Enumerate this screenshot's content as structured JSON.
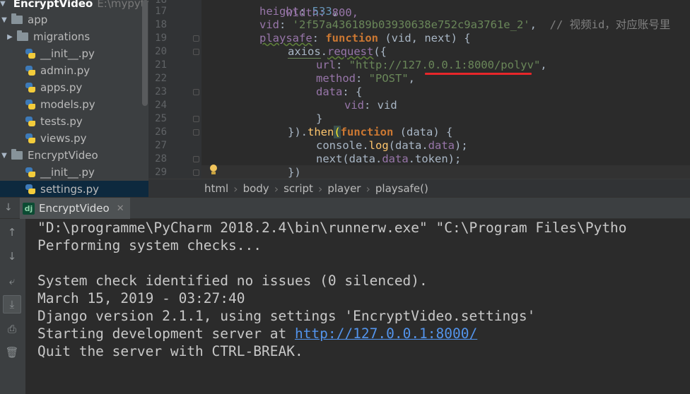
{
  "project_tree": {
    "root": {
      "label": "EncryptVideo",
      "path": "E:\\mypythor"
    },
    "items": [
      {
        "label": "app",
        "kind": "folder",
        "indent": 0,
        "expanded": true
      },
      {
        "label": "migrations",
        "kind": "folder",
        "indent": 1,
        "expanded": false
      },
      {
        "label": "__init__.py",
        "kind": "py",
        "indent": 2
      },
      {
        "label": "admin.py",
        "kind": "py",
        "indent": 2
      },
      {
        "label": "apps.py",
        "kind": "py",
        "indent": 2
      },
      {
        "label": "models.py",
        "kind": "py",
        "indent": 2
      },
      {
        "label": "tests.py",
        "kind": "py",
        "indent": 2
      },
      {
        "label": "views.py",
        "kind": "py",
        "indent": 2
      },
      {
        "label": "EncryptVideo",
        "kind": "folder",
        "indent": 0,
        "expanded": true
      },
      {
        "label": "__init__.py",
        "kind": "py",
        "indent": 2
      },
      {
        "label": "settings.py",
        "kind": "py",
        "indent": 2,
        "selected": true
      }
    ]
  },
  "editor": {
    "line_numbers": [
      "18",
      "17",
      "18",
      "19",
      "20",
      "21",
      "22",
      "23",
      "24",
      "25",
      "26",
      "27",
      "28",
      "29"
    ],
    "code": {
      "l16": "width: 800,",
      "l17_key": "height",
      "l17_val": "533",
      "l18_key": "vid",
      "l18_val": "'2f57a436189b03930638e752c9a3761e_2'",
      "l18_cmt": "// 视频id，对应账号里",
      "l19_key": "playsafe",
      "l19_kw": "function",
      "l19_args": "(vid, next) {",
      "l20_obj": "axios",
      "l20_fn": "request",
      "l20_rest": "({",
      "l21_key": "url",
      "l21_val": "\"http://127.0.0.1:8000/polyv\"",
      "l22_key": "method",
      "l22_val": "\"POST\"",
      "l23_key": "data",
      "l23_rest": "{",
      "l24_key": "vid",
      "l24_val": "vid",
      "l25": "}",
      "l26_a": "}).",
      "l26_fn": "then",
      "l26_kw": "function",
      "l26_rest": "(data) {",
      "l27_obj": "console.",
      "l27_fn": "log",
      "l27_arg": "(data.",
      "l27_prop": "data",
      "l27_end": ");",
      "l28_a": "next(data.",
      "l28_prop": "data",
      "l28_b": ".token);",
      "l29": "})"
    }
  },
  "breadcrumbs": [
    "html",
    "body",
    "script",
    "player",
    "playsafe()"
  ],
  "run_panel": {
    "tab_label": "EncryptVideo",
    "tab_icon": "dj",
    "console_lines": [
      "\"D:\\programme\\PyCharm 2018.2.4\\bin\\runnerw.exe\" \"C:\\Program Files\\Pytho",
      "Performing system checks...",
      "",
      "System check identified no issues (0 silenced).",
      "March 15, 2019 - 03:27:40",
      "Django version 2.1.1, using settings 'EncryptVideo.settings'",
      "Starting development server at ",
      "Quit the server with CTRL-BREAK."
    ],
    "server_link": "http://127.0.0.1:8000/"
  },
  "colors": {
    "keyword": "#cc7832",
    "string": "#6a8759",
    "number": "#6897bb",
    "property": "#9876aa",
    "function": "#ffc66d",
    "link": "#5394ec",
    "highlight_underline": "#e8262a"
  }
}
